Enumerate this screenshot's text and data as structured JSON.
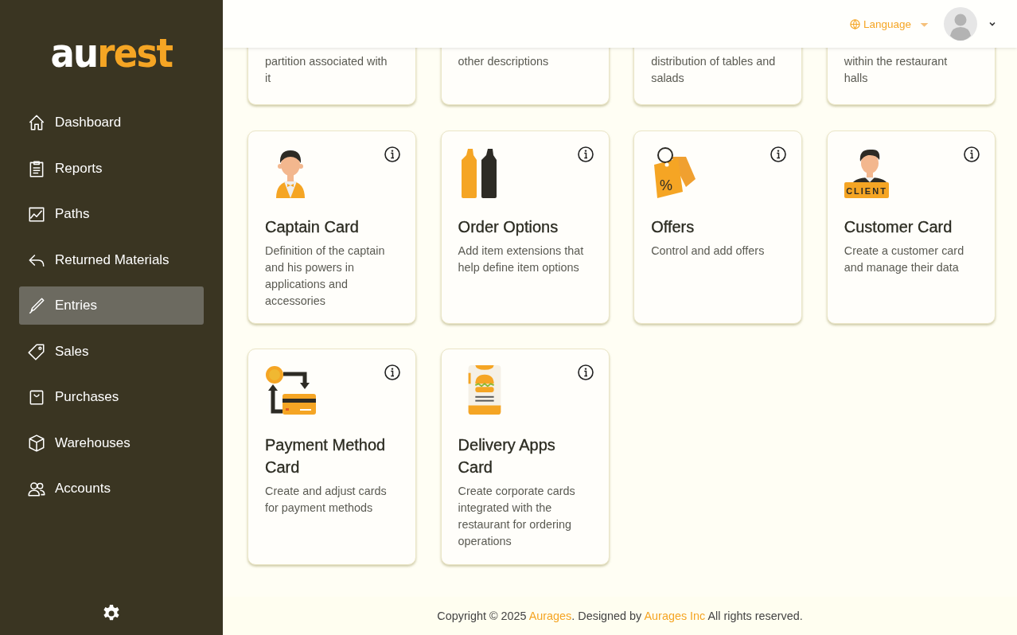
{
  "sidebar": {
    "logo": {
      "part_1": "au",
      "part_2": "rest"
    },
    "items": [
      {
        "label": "Dashboard",
        "kind": "home",
        "selected": false
      },
      {
        "label": "Reports",
        "kind": "clipboard",
        "selected": false
      },
      {
        "label": "Paths",
        "kind": "chart",
        "selected": false
      },
      {
        "label": "Returned Materials",
        "kind": "reply",
        "selected": false
      },
      {
        "label": "Entries",
        "kind": "pen",
        "selected": true
      },
      {
        "label": "Sales",
        "kind": "tag",
        "selected": false
      },
      {
        "label": "Purchases",
        "kind": "bag",
        "selected": false
      },
      {
        "label": "Warehouses",
        "kind": "box",
        "selected": false
      },
      {
        "label": "Accounts",
        "kind": "users",
        "selected": false
      }
    ]
  },
  "header": {
    "language": "Language"
  },
  "partial_cards": [
    {
      "description": "partition associated with it"
    },
    {
      "description": "other descriptions"
    },
    {
      "description": "distribution of tables and salads"
    },
    {
      "description": "within the restaurant halls"
    }
  ],
  "cards": [
    {
      "title": "Captain Card",
      "description": "Definition of the captain and his powers in applications and accessories",
      "kind": "waiter"
    },
    {
      "title": "Order Options",
      "description": "Add item extensions that help define item options",
      "kind": "bottles"
    },
    {
      "title": "Offers",
      "description": "Control and add offers",
      "kind": "tags",
      "icon_label": "%"
    },
    {
      "title": "Customer Card",
      "description": "Create a customer card and manage their data",
      "kind": "client",
      "icon_label": "CLIENT"
    },
    {
      "title": "Payment Method Card",
      "description": "Create and adjust cards for payment methods",
      "kind": "payment"
    },
    {
      "title": "Delivery Apps Card",
      "description": "Create corporate cards integrated with the restaurant for ordering operations",
      "kind": "menu"
    }
  ],
  "footer": {
    "prefix": "Copyright © 2025",
    "link_1": "Aurages",
    "middle": ". Designed by",
    "link_2": "Aurages Inc",
    "suffix": "All rights reserved."
  }
}
